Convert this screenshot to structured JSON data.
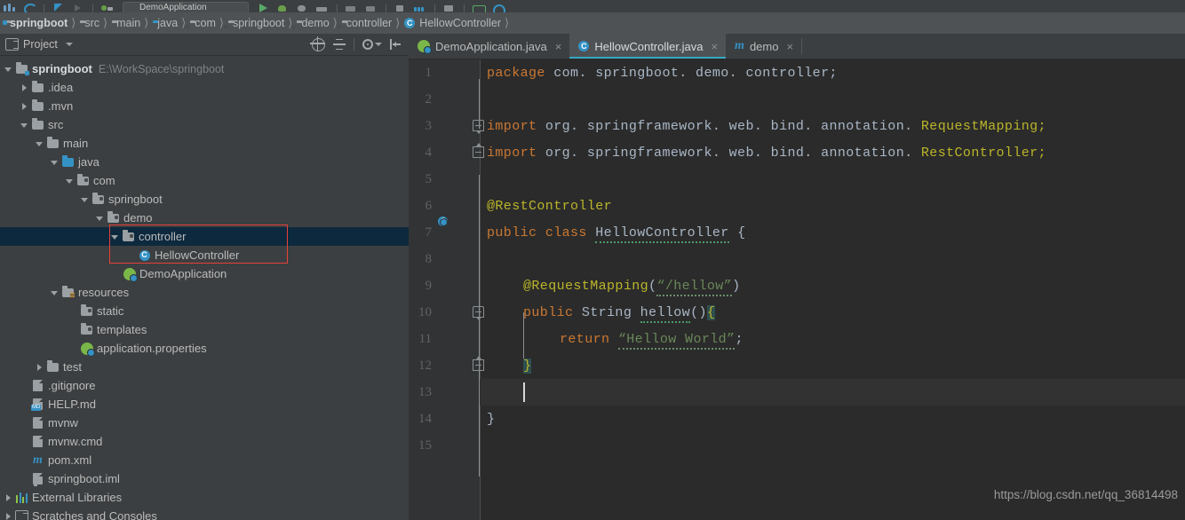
{
  "toolbar": {
    "run_config_label": "DemoApplication"
  },
  "breadcrumb": [
    {
      "label": "springboot",
      "icon": "module-icon"
    },
    {
      "label": "src",
      "icon": "folder-icon"
    },
    {
      "label": "main",
      "icon": "folder-icon"
    },
    {
      "label": "java",
      "icon": "source-folder-icon"
    },
    {
      "label": "com",
      "icon": "package-icon"
    },
    {
      "label": "springboot",
      "icon": "package-icon"
    },
    {
      "label": "demo",
      "icon": "package-icon"
    },
    {
      "label": "controller",
      "icon": "package-icon"
    },
    {
      "label": "HellowController",
      "icon": "class-icon"
    }
  ],
  "project_panel": {
    "title": "Project",
    "tools": [
      "locate-icon",
      "collapse-all-icon",
      "settings-icon",
      "hide-icon"
    ],
    "tree": [
      {
        "label": "springboot",
        "path": "E:\\WorkSpace\\springboot",
        "icon": "module-icon",
        "indent": 0,
        "twisty": "down",
        "bold": true
      },
      {
        "label": ".idea",
        "icon": "folder-icon",
        "indent": 1,
        "twisty": "right"
      },
      {
        "label": ".mvn",
        "icon": "folder-icon",
        "indent": 1,
        "twisty": "right"
      },
      {
        "label": "src",
        "icon": "folder-icon",
        "indent": 1,
        "twisty": "down"
      },
      {
        "label": "main",
        "icon": "folder-icon",
        "indent": 2,
        "twisty": "down"
      },
      {
        "label": "java",
        "icon": "source-folder-icon",
        "indent": 3,
        "twisty": "down"
      },
      {
        "label": "com",
        "icon": "package-icon",
        "indent": 4,
        "twisty": "down"
      },
      {
        "label": "springboot",
        "icon": "package-icon",
        "indent": 5,
        "twisty": "down"
      },
      {
        "label": "demo",
        "icon": "package-icon",
        "indent": 6,
        "twisty": "down"
      },
      {
        "label": "controller",
        "icon": "package-icon",
        "indent": 7,
        "twisty": "down",
        "selected": true
      },
      {
        "label": "HellowController",
        "icon": "class-icon",
        "indent": 8
      },
      {
        "label": "DemoApplication",
        "icon": "spring-class-icon",
        "indent": 7
      },
      {
        "label": "resources",
        "icon": "resources-folder-icon",
        "indent": 3,
        "twisty": "down"
      },
      {
        "label": "static",
        "icon": "package-icon",
        "indent": 4
      },
      {
        "label": "templates",
        "icon": "package-icon",
        "indent": 4
      },
      {
        "label": "application.properties",
        "icon": "spring-properties-icon",
        "indent": 4
      },
      {
        "label": "test",
        "icon": "folder-icon",
        "indent": 2,
        "twisty": "right"
      },
      {
        "label": ".gitignore",
        "icon": "file-icon",
        "indent": 1
      },
      {
        "label": "HELP.md",
        "icon": "markdown-file-icon",
        "indent": 1
      },
      {
        "label": "mvnw",
        "icon": "file-icon",
        "indent": 1
      },
      {
        "label": "mvnw.cmd",
        "icon": "file-icon",
        "indent": 1
      },
      {
        "label": "pom.xml",
        "icon": "maven-file-icon",
        "indent": 1
      },
      {
        "label": "springboot.iml",
        "icon": "iml-file-icon",
        "indent": 1
      },
      {
        "label": "External Libraries",
        "icon": "libraries-icon",
        "indent": 0,
        "twisty": "right"
      },
      {
        "label": "Scratches and Consoles",
        "icon": "scratches-icon",
        "indent": 0,
        "twisty": "right"
      }
    ]
  },
  "editor": {
    "tabs": [
      {
        "label": "DemoApplication.java",
        "icon": "spring-class-icon",
        "active": false,
        "close": "×"
      },
      {
        "label": "HellowController.java",
        "icon": "class-icon",
        "active": true,
        "close": "×"
      },
      {
        "label": "demo",
        "icon": "maven-file-icon",
        "active": false,
        "close": "×"
      }
    ],
    "line_numbers": [
      "1",
      "2",
      "3",
      "4",
      "5",
      "6",
      "7",
      "8",
      "9",
      "10",
      "11",
      "12",
      "13",
      "14",
      "15"
    ],
    "current_line": 13,
    "gutter_marks": [
      {
        "line": 7,
        "icon": "spring-bean-gutter-icon"
      }
    ],
    "code_lines": [
      {
        "n": 1,
        "text": "package com. springboot. demo. controller;"
      },
      {
        "n": 2,
        "text": ""
      },
      {
        "n": 3,
        "text": "import org. springframework. web. bind. annotation. RequestMapping;"
      },
      {
        "n": 4,
        "text": "import org. springframework. web. bind. annotation. RestController;"
      },
      {
        "n": 5,
        "text": ""
      },
      {
        "n": 6,
        "text": "@RestController"
      },
      {
        "n": 7,
        "text": "public class HellowController {"
      },
      {
        "n": 8,
        "text": ""
      },
      {
        "n": 9,
        "text": "    @RequestMapping(“/hellow”)"
      },
      {
        "n": 10,
        "text": "    public String hellow() {"
      },
      {
        "n": 11,
        "text": "        return “Hellow World”;"
      },
      {
        "n": 12,
        "text": "    }"
      },
      {
        "n": 13,
        "text": ""
      },
      {
        "n": 14,
        "text": "}"
      },
      {
        "n": 15,
        "text": ""
      }
    ],
    "tokens": {
      "kw_package": "package",
      "pkg_name": "com. springboot. demo. controller;",
      "kw_import": "import",
      "import1": "org. springframework. web. bind. annotation. ",
      "import1_cls": "RequestMapping;",
      "import2": "org. springframework. web. bind. annotation. ",
      "import2_cls": "RestController;",
      "ann_rest": "@RestController",
      "kw_public": "public",
      "kw_class": "class",
      "cls_name": "HellowController",
      "brace_open": "{",
      "ann_mapping": "@RequestMapping",
      "paren_open": "(",
      "str_path": "“/hellow”",
      "paren_close": ")",
      "ty_string": "String",
      "method_name": "hellow",
      "parens": "()",
      "kw_return": "return",
      "str_hello": "“Hellow World”",
      "semi": ";",
      "brace_close": "}"
    },
    "watermark": "https://blog.csdn.net/qq_36814498"
  },
  "colors": {
    "keyword": "#cc7832",
    "annotation": "#bbb529",
    "string": "#6a8759",
    "identifier": "#a9b7c6",
    "editor_bg": "#2b2b2b",
    "current_line_bg": "#323232",
    "gutter_bg": "#313335",
    "panel_bg": "#3c3f41",
    "selection_bg": "#0d293e",
    "accent": "#3592c4",
    "highlight_box": "#e8413a"
  }
}
